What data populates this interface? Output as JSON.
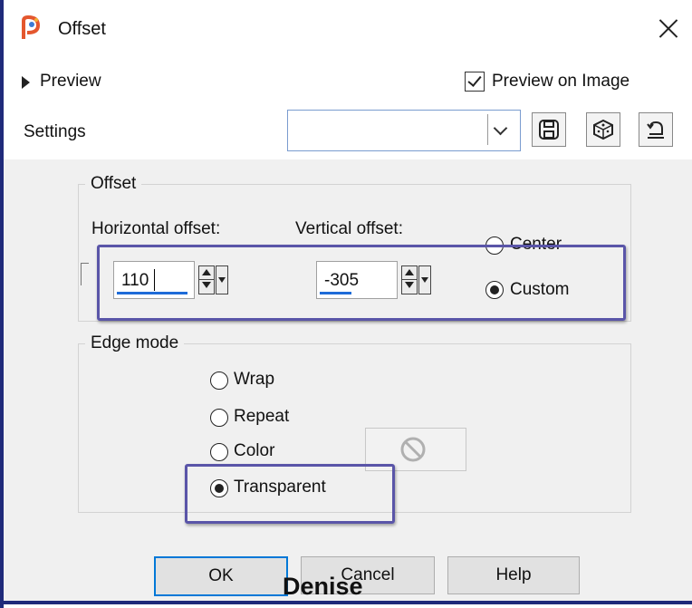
{
  "window": {
    "title": "Offset"
  },
  "preview": {
    "toggle_label": "Preview",
    "preview_on_image_label": "Preview on Image",
    "preview_on_image_checked": true
  },
  "settings": {
    "label": "Settings",
    "preset_value": ""
  },
  "offset": {
    "group_title": "Offset",
    "horizontal_label": "Horizontal offset:",
    "horizontal_value": "110",
    "vertical_label": "Vertical offset:",
    "vertical_value": "-305",
    "center_label": "Center",
    "custom_label": "Custom",
    "selected": "Custom"
  },
  "edge_mode": {
    "group_title": "Edge mode",
    "options": [
      "Wrap",
      "Repeat",
      "Color",
      "Transparent"
    ],
    "selected": "Transparent"
  },
  "buttons": {
    "ok": "OK",
    "cancel": "Cancel",
    "help": "Help"
  },
  "watermark": "Denise",
  "icons": {
    "app": "paintshop-pro-icon",
    "close": "close-icon",
    "save_preset": "floppy-disk-icon",
    "random": "dice-icon",
    "reset": "reset-icon",
    "no_color": "no-symbol-icon"
  },
  "colors": {
    "highlight": "#5a55a8",
    "frame": "#1f2a7a",
    "focus": "#0078d7"
  }
}
